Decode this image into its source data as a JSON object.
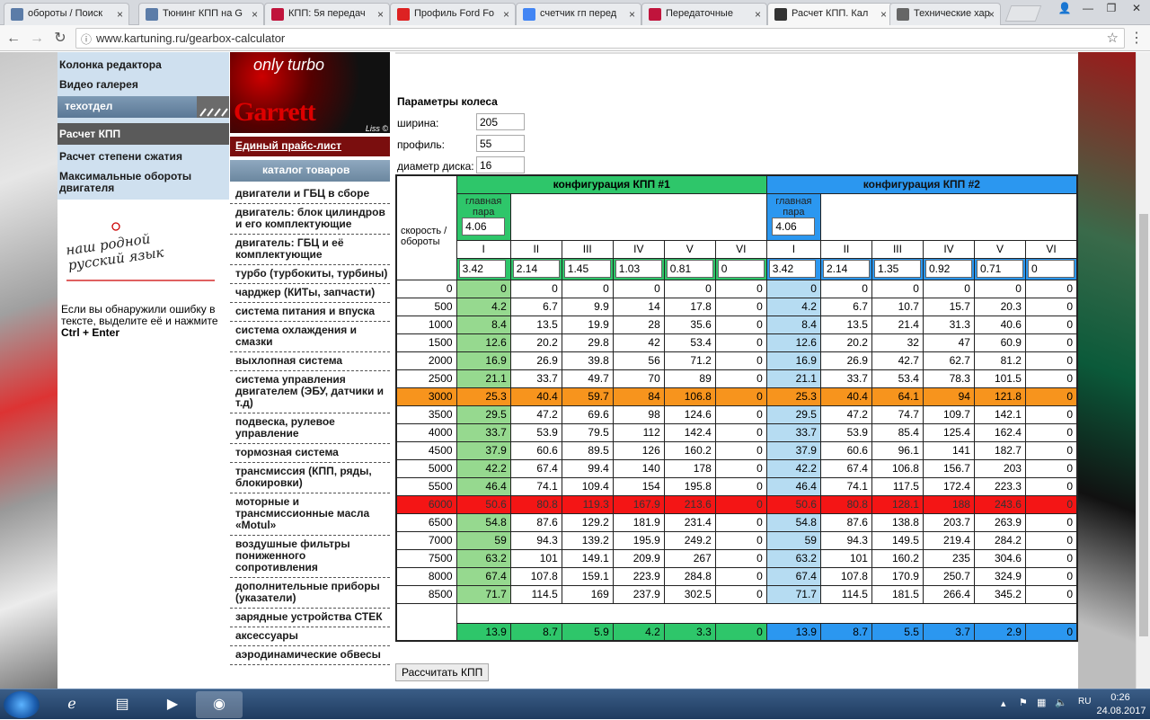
{
  "browser": {
    "tabs": [
      {
        "label": "обороты / Поиск",
        "icon": "generic-site-icon",
        "color": "#5b7ca8"
      },
      {
        "label": "Тюнинг КПП на G",
        "icon": "generic-site-icon",
        "color": "#5b7ca8"
      },
      {
        "label": "КПП: 5я передач",
        "icon": "drive2-icon",
        "color": "#c0143c"
      },
      {
        "label": "Профиль Ford Fo",
        "icon": "ford-forum-icon",
        "color": "#d22"
      },
      {
        "label": "счетчик гп перед",
        "icon": "google-icon",
        "color": "#4285f4"
      },
      {
        "label": "Передаточные",
        "icon": "drive2-icon",
        "color": "#c0143c"
      },
      {
        "label": "Расчет КПП. Кал",
        "icon": "kartuning-icon",
        "color": "#333"
      },
      {
        "label": "Технические хар",
        "icon": "car-icon",
        "color": "#666"
      }
    ],
    "url": "www.kartuning.ru/gearbox-calculator"
  },
  "left_nav": {
    "top_items": [
      "Колонка редактора",
      "Видео галерея"
    ],
    "section_header": "техотдел",
    "active_item": "Расчет КПП",
    "items": [
      "Расчет степени сжатия",
      "Максимальные обороты двигателя"
    ],
    "handwriting": "наш родной русский язык",
    "error_note": "Если вы обнаружили ошибку в тексте, выделите её и нажмите",
    "error_keys": "Ctrl + Enter"
  },
  "middle": {
    "banner_top": "only turbo",
    "banner_brand": "Garrett",
    "banner_sign": "Liss ©",
    "price_list": "Единый прайс-лист",
    "catalog_header": "каталог товаров",
    "catalog": [
      "двигатели и ГБЦ в сборе",
      "двигатель: блок цилиндров и его комплектующие",
      "двигатель: ГБЦ и её комплектующие",
      "турбо (турбокиты, турбины)",
      "чарджер (КИТы, запчасти)",
      "система питания и впуска",
      "система охлаждения и смазки",
      "выхлопная система",
      "система управления двигателем (ЭБУ, датчики и т.д)",
      "подвеска, рулевое управление",
      "тормозная система",
      "трансмиссия (КПП, ряды, блокировки)",
      "моторные и трансмиссионные масла «Motul»",
      "воздушные фильтры пониженного сопротивления",
      "дополнительные приборы (указатели)",
      "зарядные устройства СТЕК",
      "аксессуары",
      "аэродинамические обвесы"
    ]
  },
  "wheel": {
    "title": "Параметры колеса",
    "width_label": "ширина:",
    "width": "205",
    "profile_label": "профиль:",
    "profile": "55",
    "diameter_label": "диаметр диска:",
    "diameter": "16"
  },
  "table": {
    "speed_label": "скорость / обороты",
    "config1_title": "конфигурация КПП #1",
    "config2_title": "конфигурация КПП #2",
    "main_pair_label": "главная пара",
    "main_pair1": "4.06",
    "main_pair2": "4.06",
    "gears": [
      "I",
      "II",
      "III",
      "IV",
      "V",
      "VI"
    ],
    "ratios1": [
      "3.42",
      "2.14",
      "1.45",
      "1.03",
      "0.81",
      "0"
    ],
    "ratios2": [
      "3.42",
      "2.14",
      "1.35",
      "0.92",
      "0.71",
      "0"
    ],
    "highlight_orange_rpm": "3000",
    "highlight_red_rpm": "6000",
    "rows": [
      {
        "rpm": "0",
        "c1": [
          "0",
          "0",
          "0",
          "0",
          "0",
          "0"
        ],
        "c2": [
          "0",
          "0",
          "0",
          "0",
          "0",
          "0"
        ]
      },
      {
        "rpm": "500",
        "c1": [
          "4.2",
          "6.7",
          "9.9",
          "14",
          "17.8",
          "0"
        ],
        "c2": [
          "4.2",
          "6.7",
          "10.7",
          "15.7",
          "20.3",
          "0"
        ]
      },
      {
        "rpm": "1000",
        "c1": [
          "8.4",
          "13.5",
          "19.9",
          "28",
          "35.6",
          "0"
        ],
        "c2": [
          "8.4",
          "13.5",
          "21.4",
          "31.3",
          "40.6",
          "0"
        ]
      },
      {
        "rpm": "1500",
        "c1": [
          "12.6",
          "20.2",
          "29.8",
          "42",
          "53.4",
          "0"
        ],
        "c2": [
          "12.6",
          "20.2",
          "32",
          "47",
          "60.9",
          "0"
        ]
      },
      {
        "rpm": "2000",
        "c1": [
          "16.9",
          "26.9",
          "39.8",
          "56",
          "71.2",
          "0"
        ],
        "c2": [
          "16.9",
          "26.9",
          "42.7",
          "62.7",
          "81.2",
          "0"
        ]
      },
      {
        "rpm": "2500",
        "c1": [
          "21.1",
          "33.7",
          "49.7",
          "70",
          "89",
          "0"
        ],
        "c2": [
          "21.1",
          "33.7",
          "53.4",
          "78.3",
          "101.5",
          "0"
        ]
      },
      {
        "rpm": "3000",
        "c1": [
          "25.3",
          "40.4",
          "59.7",
          "84",
          "106.8",
          "0"
        ],
        "c2": [
          "25.3",
          "40.4",
          "64.1",
          "94",
          "121.8",
          "0"
        ]
      },
      {
        "rpm": "3500",
        "c1": [
          "29.5",
          "47.2",
          "69.6",
          "98",
          "124.6",
          "0"
        ],
        "c2": [
          "29.5",
          "47.2",
          "74.7",
          "109.7",
          "142.1",
          "0"
        ]
      },
      {
        "rpm": "4000",
        "c1": [
          "33.7",
          "53.9",
          "79.5",
          "112",
          "142.4",
          "0"
        ],
        "c2": [
          "33.7",
          "53.9",
          "85.4",
          "125.4",
          "162.4",
          "0"
        ]
      },
      {
        "rpm": "4500",
        "c1": [
          "37.9",
          "60.6",
          "89.5",
          "126",
          "160.2",
          "0"
        ],
        "c2": [
          "37.9",
          "60.6",
          "96.1",
          "141",
          "182.7",
          "0"
        ]
      },
      {
        "rpm": "5000",
        "c1": [
          "42.2",
          "67.4",
          "99.4",
          "140",
          "178",
          "0"
        ],
        "c2": [
          "42.2",
          "67.4",
          "106.8",
          "156.7",
          "203",
          "0"
        ]
      },
      {
        "rpm": "5500",
        "c1": [
          "46.4",
          "74.1",
          "109.4",
          "154",
          "195.8",
          "0"
        ],
        "c2": [
          "46.4",
          "74.1",
          "117.5",
          "172.4",
          "223.3",
          "0"
        ]
      },
      {
        "rpm": "6000",
        "c1": [
          "50.6",
          "80.8",
          "119.3",
          "167.9",
          "213.6",
          "0"
        ],
        "c2": [
          "50.6",
          "80.8",
          "128.1",
          "188",
          "243.6",
          "0"
        ]
      },
      {
        "rpm": "6500",
        "c1": [
          "54.8",
          "87.6",
          "129.2",
          "181.9",
          "231.4",
          "0"
        ],
        "c2": [
          "54.8",
          "87.6",
          "138.8",
          "203.7",
          "263.9",
          "0"
        ]
      },
      {
        "rpm": "7000",
        "c1": [
          "59",
          "94.3",
          "139.2",
          "195.9",
          "249.2",
          "0"
        ],
        "c2": [
          "59",
          "94.3",
          "149.5",
          "219.4",
          "284.2",
          "0"
        ]
      },
      {
        "rpm": "7500",
        "c1": [
          "63.2",
          "101",
          "149.1",
          "209.9",
          "267",
          "0"
        ],
        "c2": [
          "63.2",
          "101",
          "160.2",
          "235",
          "304.6",
          "0"
        ]
      },
      {
        "rpm": "8000",
        "c1": [
          "67.4",
          "107.8",
          "159.1",
          "223.9",
          "284.8",
          "0"
        ],
        "c2": [
          "67.4",
          "107.8",
          "170.9",
          "250.7",
          "324.9",
          "0"
        ]
      },
      {
        "rpm": "8500",
        "c1": [
          "71.7",
          "114.5",
          "169",
          "237.9",
          "302.5",
          "0"
        ],
        "c2": [
          "71.7",
          "114.5",
          "181.5",
          "266.4",
          "345.2",
          "0"
        ]
      }
    ],
    "totals1": [
      "13.9",
      "8.7",
      "5.9",
      "4.2",
      "3.3",
      "0"
    ],
    "totals2": [
      "13.9",
      "8.7",
      "5.5",
      "3.7",
      "2.9",
      "0"
    ]
  },
  "calc_button": "Рассчитать КПП",
  "taskbar": {
    "time": "0:26",
    "date": "24.08.2017"
  },
  "colors": {
    "config1": "#2ec66a",
    "config2": "#2b97f0",
    "highlight_orange": "#f7941d",
    "highlight_red": "#f41515"
  }
}
